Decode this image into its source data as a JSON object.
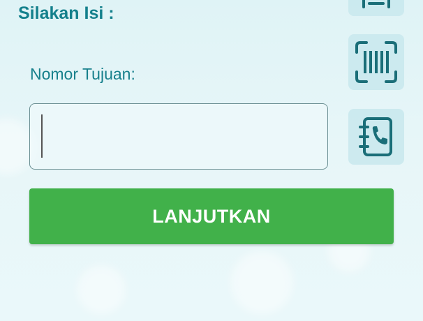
{
  "form": {
    "section_title": "Silakan Isi :",
    "field_label": "Nomor Tujuan:",
    "field_value": "",
    "submit_label": "LANJUTKAN"
  },
  "icons": {
    "top_partial": "partially-visible-icon",
    "barcode": "barcode-scan-icon",
    "contacts": "phone-book-icon"
  },
  "colors": {
    "accent": "#14808C",
    "icon": "#1A6E78",
    "button": "#41B14A",
    "tile": "#C8E8ED"
  }
}
